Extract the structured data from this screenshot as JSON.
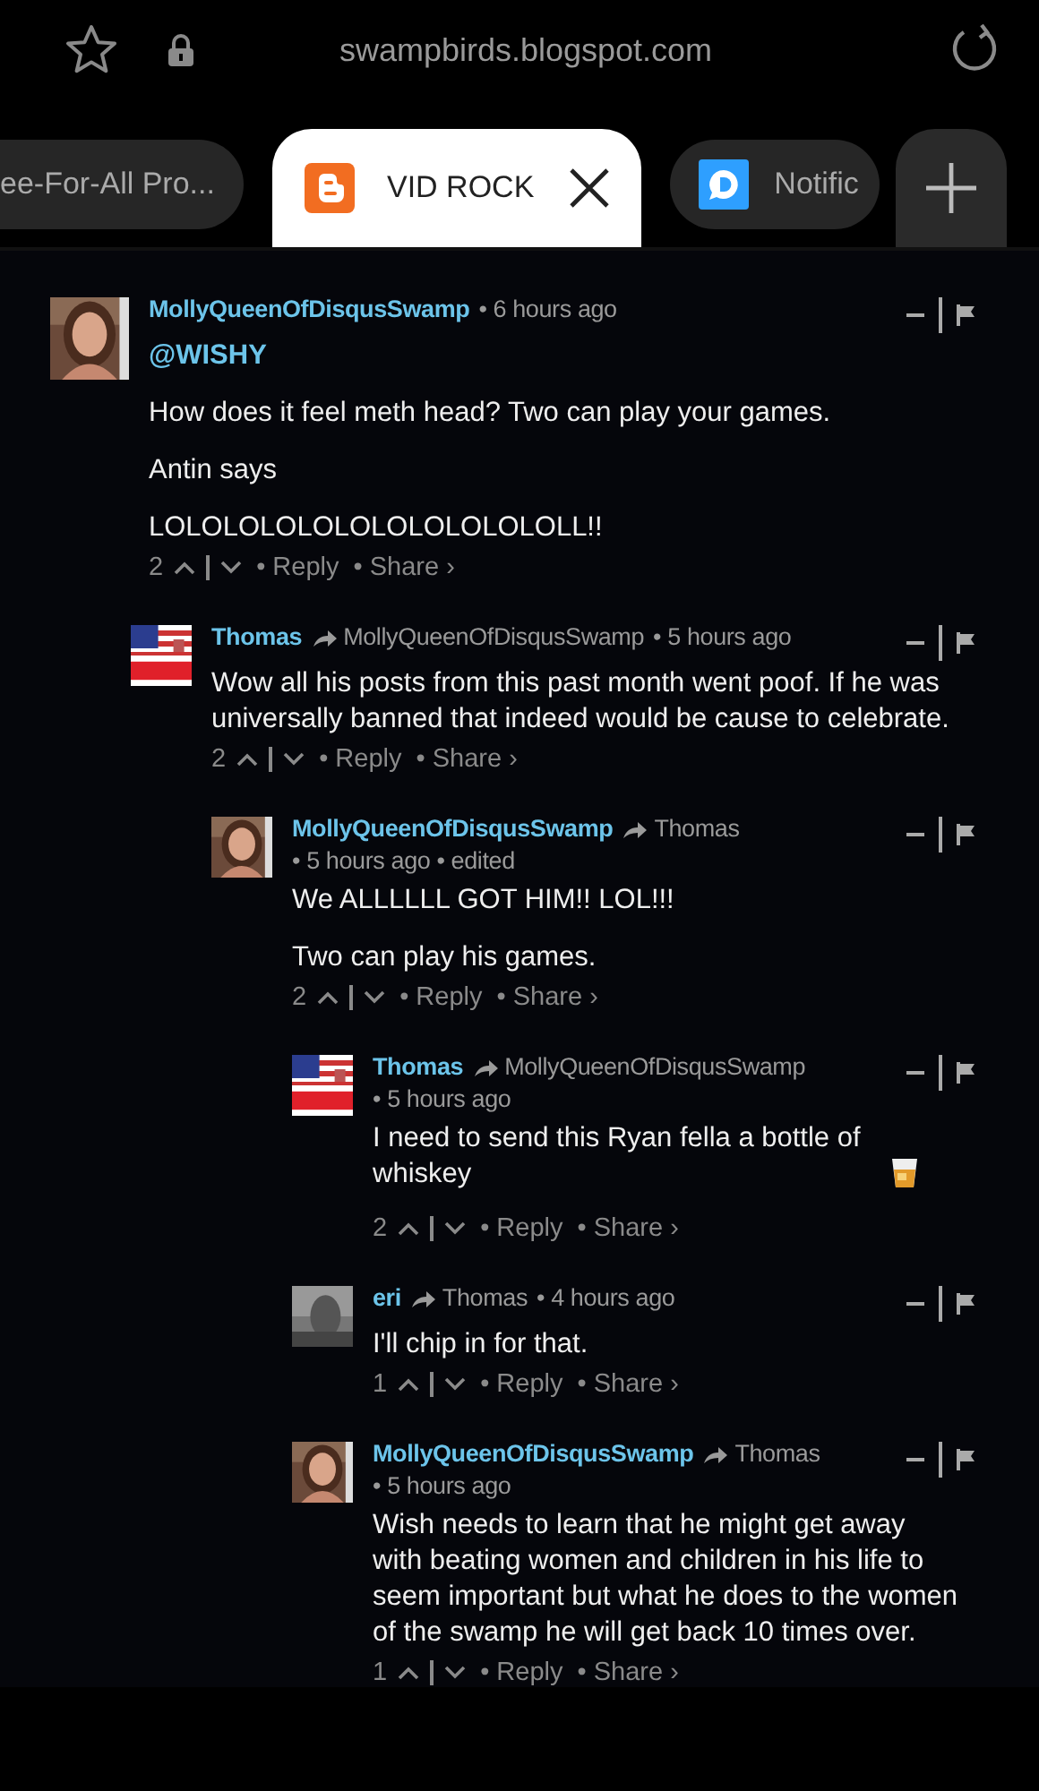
{
  "browser": {
    "url": "swampbirds.blogspot.com"
  },
  "tabs": [
    {
      "label": "ee-For-All Pro...",
      "selected": false
    },
    {
      "label": "VID ROCK",
      "selected": true
    },
    {
      "label": "Notific",
      "selected": false
    }
  ],
  "comments": [
    {
      "author": "MollyQueenOfDisqusSwamp",
      "meta": "• 6 hours ago",
      "mention": "@WISHY",
      "body": [
        "How does it feel meth head? Two can play your games.",
        "Antin says",
        "LOLOLOLOLOLOLOLOLOLOLOLL!!"
      ],
      "votes": "2",
      "reply": "• Reply",
      "share": "• Share ›",
      "children": [
        {
          "author": "Thomas",
          "reply_to": "MollyQueenOfDisqusSwamp",
          "meta": "• 5 hours ago",
          "body": [
            "Wow all his posts from this past month went poof. If he was universally banned that indeed would be cause to celebrate."
          ],
          "votes": "2",
          "reply": "• Reply",
          "share": "• Share ›",
          "children": [
            {
              "author": "MollyQueenOfDisqusSwamp",
              "reply_to": "Thomas",
              "meta": "• 5 hours ago • edited",
              "body": [
                "We ALLLLLL GOT HIM!! LOL!!!",
                "Two can play his games."
              ],
              "votes": "2",
              "reply": "• Reply",
              "share": "• Share ›",
              "children": [
                {
                  "author": "Thomas",
                  "reply_to": "MollyQueenOfDisqusSwamp",
                  "meta": "• 5 hours ago",
                  "body": [
                    "I need to send this Ryan fella a bottle of whiskey"
                  ],
                  "emoji": true,
                  "votes": "2",
                  "reply": "• Reply",
                  "share": "• Share ›"
                },
                {
                  "author": "eri",
                  "reply_to": "Thomas",
                  "meta": "• 4 hours ago",
                  "body": [
                    "I'll chip in for that."
                  ],
                  "votes": "1",
                  "reply": "• Reply",
                  "share": "• Share ›"
                },
                {
                  "author": "MollyQueenOfDisqusSwamp",
                  "reply_to": "Thomas",
                  "meta": "• 5 hours ago",
                  "body": [
                    "Wish needs to learn that he might get away with beating women and children in his life to seem important but what he does to the women of the swamp he will get back 10 times over."
                  ],
                  "votes": "1",
                  "reply": "• Reply",
                  "share": "• Share ›"
                }
              ]
            }
          ]
        }
      ]
    }
  ]
}
